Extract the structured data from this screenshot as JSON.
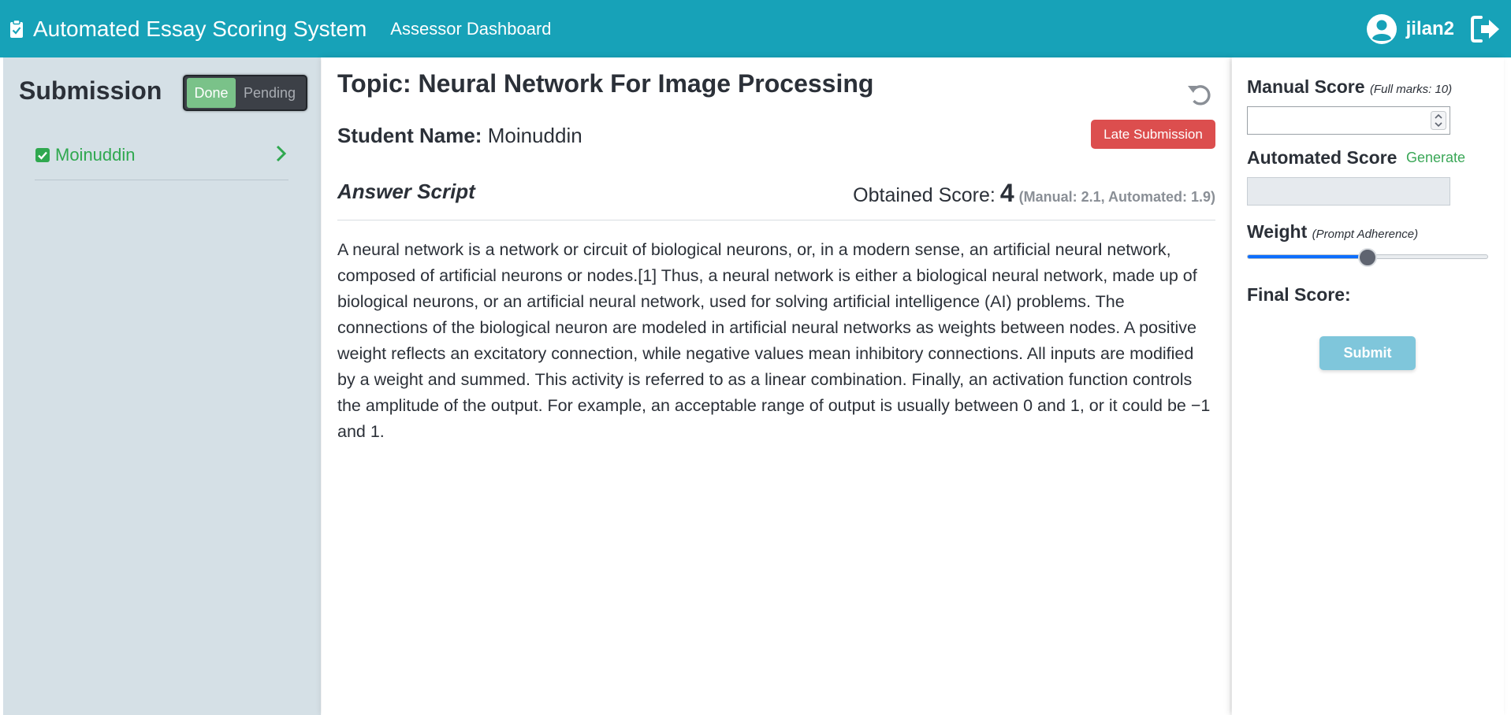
{
  "navbar": {
    "brand_icon": "clipboard-check-icon",
    "title": "Automated Essay Scoring System",
    "link": "Assessor Dashboard",
    "username": "jilan2",
    "user_icon": "user-circle-icon",
    "logout_icon": "sign-out-icon",
    "color": "#17a2b8"
  },
  "sidebar": {
    "title": "Submission",
    "toggle": {
      "done_label": "Done",
      "pending_label": "Pending",
      "active": "Done"
    },
    "items": [
      {
        "name": "Moinuddin",
        "status_icon": "check-square-icon",
        "arrow_icon": "chevron-right-icon"
      }
    ]
  },
  "main": {
    "topic_label": "Topic: Neural Network For Image Processing",
    "student_label": "Student Name:",
    "student_name": "Moinuddin",
    "badge": "Late Submission",
    "answer_title": "Answer Script",
    "obtained_label": "Obtained Score:",
    "obtained_value": "4",
    "obtained_detail": "(Manual: 2.1, Automated: 1.9)",
    "essay": "A neural network is a network or circuit of biological neurons, or, in a modern sense, an artificial neural network, composed of artificial neurons or nodes.[1] Thus, a neural network is either a biological neural network, made up of biological neurons, or an artificial neural network, used for solving artificial intelligence (AI) problems. The connections of the biological neuron are modeled in artificial neural networks as weights between nodes. A positive weight reflects an excitatory connection, while negative values mean inhibitory connections. All inputs are modified by a weight and summed. This activity is referred to as a linear combination. Finally, an activation function controls the amplitude of the output. For example, an acceptable range of output is usually between 0 and 1, or it could be −1 and 1."
  },
  "scoring": {
    "manual_label": "Manual Score",
    "manual_note": "(Full marks: 10)",
    "manual_value": "",
    "automated_label": "Automated Score",
    "generate_label": "Generate",
    "automated_value": "",
    "weight_label": "Weight",
    "weight_note": "(Prompt Adherence)",
    "weight_value": 0.5,
    "final_label": "Final Score:",
    "submit_label": "Submit"
  }
}
